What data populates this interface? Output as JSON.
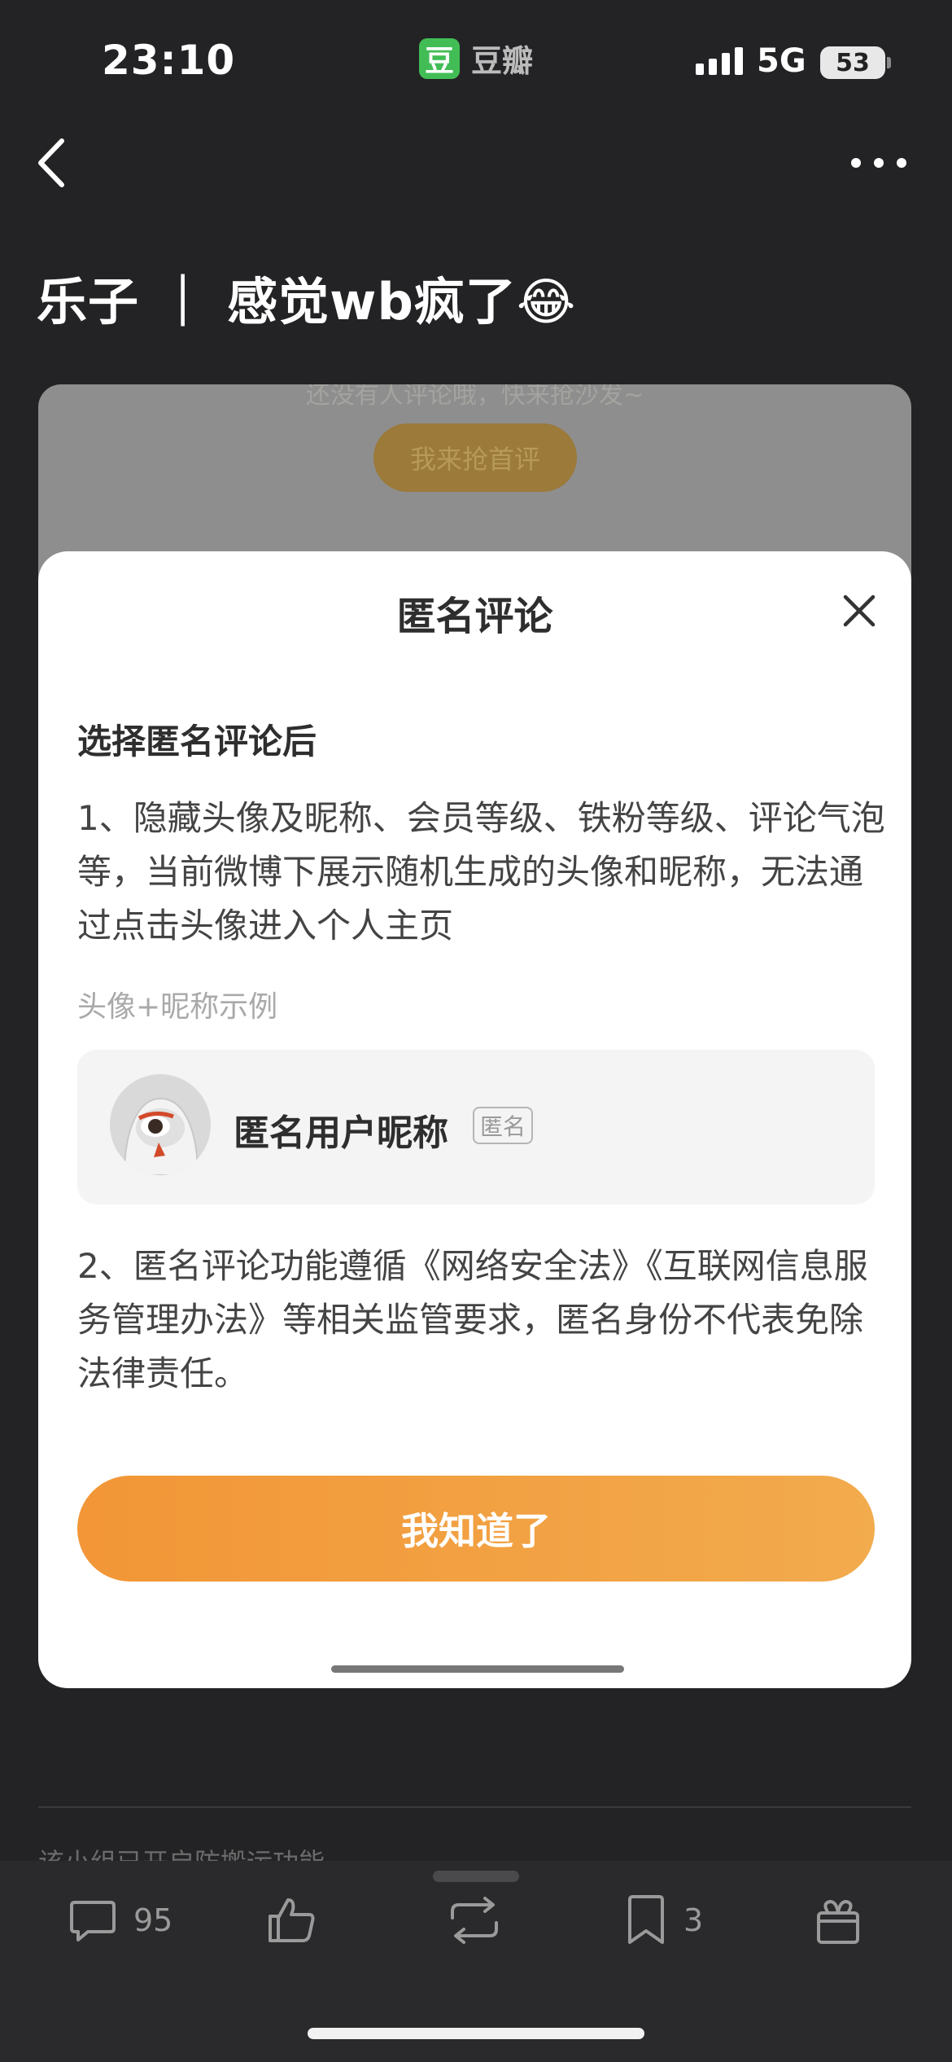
{
  "status_bar": {
    "time": "23:10",
    "app_name": "豆瓣",
    "app_logo_char": "豆",
    "network": "5G",
    "battery": "53"
  },
  "post": {
    "title": "乐子 ｜ 感觉wb疯了😂"
  },
  "background_card": {
    "hint": "还没有人评论哦，快来抢沙发~",
    "first_comment_button": "我来抢首评"
  },
  "modal": {
    "title": "匿名评论",
    "section_title": "选择匿名评论后",
    "item1": "1、隐藏头像及昵称、会员等级、铁粉等级、评论气泡等，当前微博下展示随机生成的头像和昵称，无法通过点击头像进入个人主页",
    "example_label": "头像+昵称示例",
    "example_name": "匿名用户昵称",
    "example_tag": "匿名",
    "item2": "2、匿名评论功能遵循《网络安全法》《互联网信息服务管理办法》等相关监管要求，匿名身份不代表免除法律责任。",
    "confirm_button": "我知道了"
  },
  "footer": {
    "antitheft_notice": "该小组已开启防搬运功能",
    "comment_count": "95",
    "collect_count": "3"
  },
  "colors": {
    "background": "#232325",
    "accent_orange": "#f29637",
    "douban_green": "#42bd56"
  },
  "icons": [
    "back-icon",
    "more-icon",
    "close-icon",
    "comment-icon",
    "like-icon",
    "repost-icon",
    "collect-icon",
    "gift-icon"
  ]
}
